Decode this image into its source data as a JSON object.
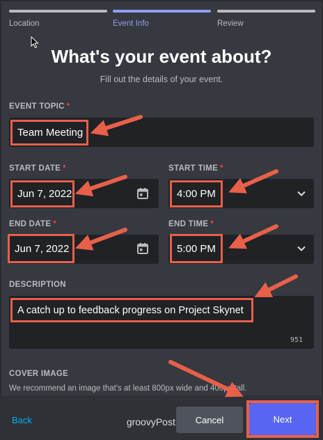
{
  "stepper": {
    "steps": [
      {
        "label": "Location"
      },
      {
        "label": "Event Info"
      },
      {
        "label": "Review"
      }
    ]
  },
  "header": {
    "title": "What's your event about?",
    "subtitle": "Fill out the details of your event."
  },
  "form": {
    "topic": {
      "label": "EVENT TOPIC",
      "value": "Team Meeting"
    },
    "start_date": {
      "label": "START DATE",
      "value": "Jun 7, 2022"
    },
    "start_time": {
      "label": "START TIME",
      "value": "4:00 PM"
    },
    "end_date": {
      "label": "END DATE",
      "value": "Jun 7, 2022"
    },
    "end_time": {
      "label": "END TIME",
      "value": "5:00 PM"
    },
    "description": {
      "label": "DESCRIPTION",
      "value": "A catch up to feedback progress on Project Skynet",
      "counter": "951"
    },
    "required_marker": "*",
    "cover": {
      "label": "COVER IMAGE",
      "hint": "We recommend an image that's at least 800px wide and 400px tall."
    }
  },
  "footer": {
    "back_label": "Back",
    "cancel_label": "Cancel",
    "next_label": "Next"
  },
  "watermark": "groovyPost.com",
  "colors": {
    "accent": "#5865f2",
    "annotation": "#e8604a",
    "link": "#00b0f4",
    "required": "#ed4245"
  }
}
